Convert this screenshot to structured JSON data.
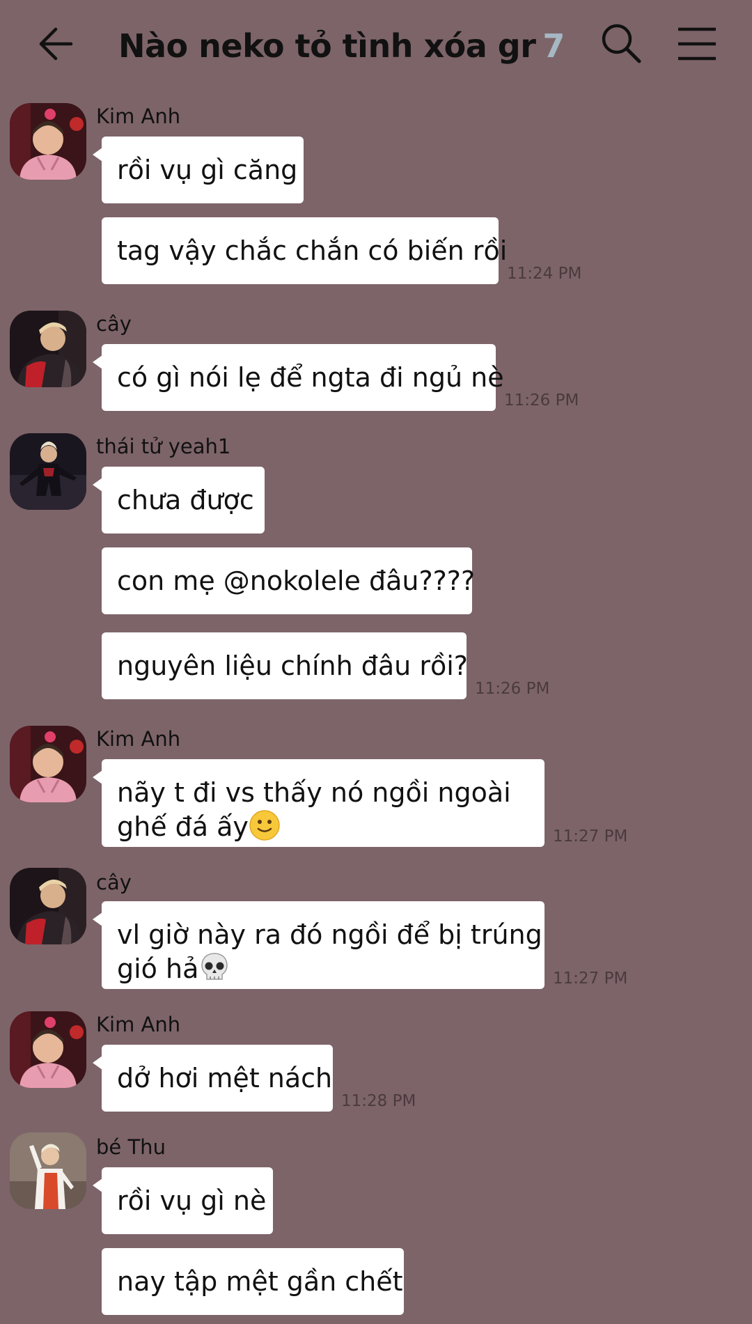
{
  "header": {
    "title": "Nào neko tỏ tình xóa gr",
    "member_count": "7",
    "icons": [
      "arrow-left-icon",
      "search-icon",
      "hamburger-menu-icon"
    ]
  },
  "messages": [
    {
      "sender": "Kim Anh",
      "texts": [
        "rồi vụ gì căng",
        "tag vậy chắc chắn có biến rồi"
      ],
      "time": "11:24 PM"
    },
    {
      "sender": "cây",
      "texts": [
        "có gì nói lẹ để ngta đi ngủ nè"
      ],
      "time": "11:26 PM"
    },
    {
      "sender": "thái tử yeah1",
      "texts": [
        "chưa được",
        "con mẹ @nokolele đâu????",
        "nguyên liệu chính đâu rồi?"
      ],
      "time": "11:26 PM"
    },
    {
      "sender": "Kim Anh",
      "texts": [
        "nãy t đi vs thấy nó ngồi ngoài",
        "ghế đá ấy"
      ],
      "emoji": "slightly-smiling-face",
      "time": "11:27 PM"
    },
    {
      "sender": "cây",
      "texts": [
        "vl giờ này ra đó ngồi để bị trúng",
        "gió hả"
      ],
      "emoji": "skull",
      "time": "11:27 PM"
    },
    {
      "sender": "Kim Anh",
      "texts": [
        "dở hơi mệt nách"
      ],
      "time": "11:28 PM"
    },
    {
      "sender": "bé Thu",
      "texts": [
        "rồi vụ gì nè",
        "nay tập mệt gần chết"
      ],
      "time": ""
    }
  ],
  "colors": {
    "background": "#7d6469",
    "bubble": "#ffffff",
    "member_count": "#a6b8c4",
    "timestamp": "#4a3a3e"
  }
}
